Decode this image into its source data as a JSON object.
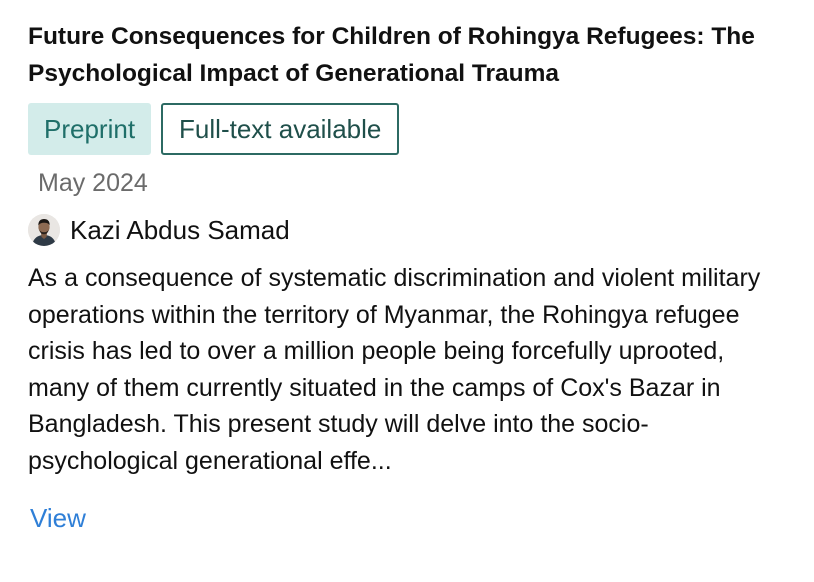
{
  "publication": {
    "title": "Future Consequences for Children of Rohingya Refugees: The Psychological Impact of Generational Trauma",
    "badges": {
      "type": "Preprint",
      "availability": "Full-text available"
    },
    "date": "May 2024",
    "author": {
      "name": "Kazi Abdus Samad",
      "avatar_icon": "person-avatar"
    },
    "abstract": "As a consequence of systematic discrimination and violent military operations within the territory of Myanmar, the Rohingya refugee crisis has led to over a million people being forcefully uprooted, many of them currently situated in the camps of Cox's Bazar in Bangladesh. This present study will delve into the socio-psychological generational effe...",
    "view_label": "View"
  },
  "colors": {
    "preprint_badge_bg": "#d3ecea",
    "preprint_badge_text": "#1f6f69",
    "fulltext_border": "#2c6a63",
    "link": "#2f7fd7",
    "muted_text": "#6b6b6b"
  }
}
